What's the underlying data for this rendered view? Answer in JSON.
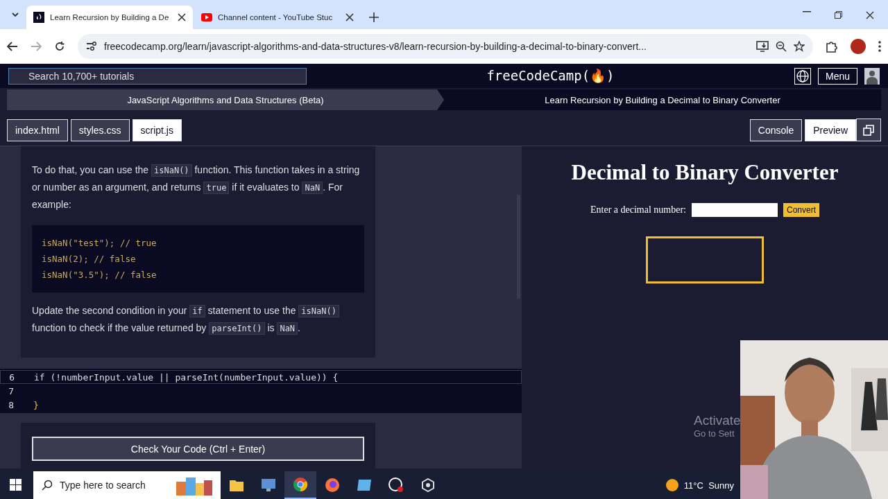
{
  "browser": {
    "tabs": [
      {
        "title": "Learn Recursion by Building a De",
        "selected": true
      },
      {
        "title": "Channel content - YouTube Stuc",
        "selected": false
      }
    ],
    "url": "freecodecamp.org/learn/javascript-algorithms-and-data-structures-v8/learn-recursion-by-building-a-decimal-to-binary-convert..."
  },
  "nav": {
    "search_placeholder": "Search 10,700+ tutorials",
    "logo": "freeCodeCamp(🔥)",
    "menu": "Menu"
  },
  "breadcrumbs": [
    "JavaScript Algorithms and Data Structures (Beta)",
    "Learn Recursion by Building a Decimal to Binary Converter"
  ],
  "file_tabs": [
    {
      "label": "index.html",
      "selected": false
    },
    {
      "label": "styles.css",
      "selected": false
    },
    {
      "label": "script.js",
      "selected": true
    }
  ],
  "panel_buttons": [
    {
      "label": "Console",
      "selected": false
    },
    {
      "label": "Preview",
      "selected": true
    }
  ],
  "instructions": [
    {
      "kind": "paragraph",
      "parts": [
        {
          "kind": "text",
          "text": "To do that, you can use the "
        },
        {
          "kind": "code",
          "text": "isNaN()"
        },
        {
          "kind": "text",
          "text": " function. This function takes in a string or number as an argument, and returns "
        },
        {
          "kind": "code",
          "text": "true"
        },
        {
          "kind": "text",
          "text": " if it evaluates to "
        },
        {
          "kind": "code",
          "text": "NaN"
        },
        {
          "kind": "text",
          "text": ". For example:"
        }
      ]
    },
    {
      "kind": "code_block",
      "lines": [
        "isNaN(\"test\"); // true",
        "isNaN(2); // false",
        "isNaN(\"3.5\"); // false"
      ]
    },
    {
      "kind": "paragraph",
      "parts": [
        {
          "kind": "text",
          "text": "Update the second condition in your "
        },
        {
          "kind": "code",
          "text": "if"
        },
        {
          "kind": "text",
          "text": " statement to use the "
        },
        {
          "kind": "code",
          "text": "isNaN()"
        },
        {
          "kind": "text",
          "text": " function to check if the value returned by "
        },
        {
          "kind": "code",
          "text": "parseInt()"
        },
        {
          "kind": "text",
          "text": " is "
        },
        {
          "kind": "code",
          "text": "NaN"
        },
        {
          "kind": "text",
          "text": "."
        }
      ]
    }
  ],
  "editor": [
    {
      "number": "6",
      "text": "if (!numberInput.value || parseInt(numberInput.value)) {",
      "current": true
    },
    {
      "number": "7",
      "current": false
    },
    {
      "number": "8",
      "text": "}",
      "current": false
    }
  ],
  "check_button": "Check Your Code (Ctrl + Enter)",
  "preview": {
    "title": "Decimal to Binary Converter",
    "label": "Enter a decimal number:",
    "button": "Convert"
  },
  "watermark": {
    "title": "Activate",
    "subtitle": "Go to Sett"
  },
  "webcam": {
    "kind": "picture"
  },
  "taskbar": {
    "search_placeholder": "Type here to search",
    "apps": [
      {
        "selected": false
      },
      {
        "selected": false
      },
      {
        "selected": true
      },
      {
        "selected": false
      },
      {
        "selected": false
      },
      {
        "selected": false
      },
      {
        "selected": false
      }
    ],
    "weather": "11°C  Sunny"
  }
}
